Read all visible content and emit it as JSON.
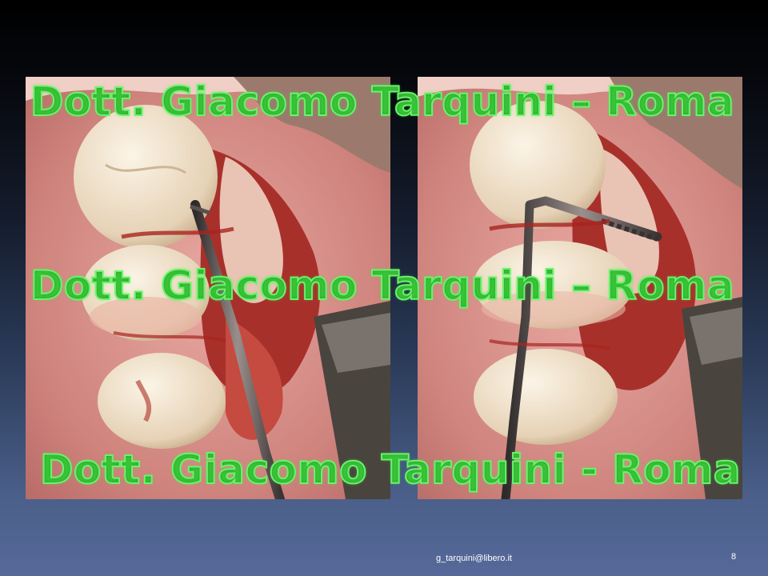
{
  "slide": {
    "watermarks": [
      "Dott. Giacomo Tarquini – Roma",
      "Dott. Giacomo Tarquini – Roma",
      "Dott. Giacomo Tarquini - Roma"
    ],
    "footer_email": "g_tarquini@libero.it",
    "slide_number": "8"
  },
  "colors": {
    "watermark_stroke": "#6cf26c",
    "gum": "#d98a86",
    "blood": "#b22222",
    "enamel": "#f1e6d2"
  }
}
